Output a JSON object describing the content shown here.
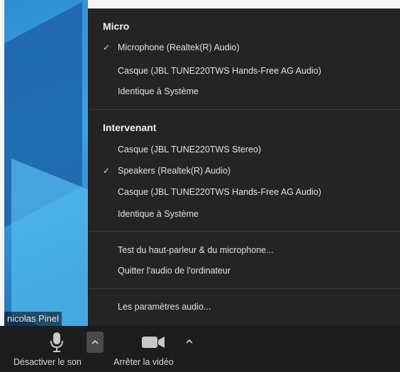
{
  "participant": {
    "name": "nicolas Pinel"
  },
  "audio_menu": {
    "micro_section": {
      "title": "Micro",
      "items": [
        {
          "label": "Microphone (Realtek(R) Audio)",
          "checked": true,
          "check_glyph": "✓"
        },
        {
          "label": "Casque (JBL TUNE220TWS Hands-Free AG Audio)",
          "checked": false,
          "check_glyph": ""
        },
        {
          "label": "Identique à Système",
          "checked": false,
          "check_glyph": ""
        }
      ]
    },
    "speaker_section": {
      "title": "Intervenant",
      "items": [
        {
          "label": "Casque (JBL TUNE220TWS Stereo)",
          "checked": false,
          "check_glyph": ""
        },
        {
          "label": "Speakers (Realtek(R) Audio)",
          "checked": true,
          "check_glyph": "✓"
        },
        {
          "label": "Casque (JBL TUNE220TWS Hands-Free AG Audio)",
          "checked": false,
          "check_glyph": ""
        },
        {
          "label": "Identique à Système",
          "checked": false,
          "check_glyph": ""
        }
      ]
    },
    "actions": {
      "test_label": "Test du haut-parleur & du microphone...",
      "leave_label": "Quitter l'audio de l'ordinateur",
      "settings_label": "Les paramètres audio..."
    }
  },
  "toolbar": {
    "mute_label": "Désactiver le son",
    "mute_icon": "microphone-icon",
    "stop_video_label": "Arrêter la vidéo",
    "video_icon": "video-camera-icon",
    "caret_icon": "chevron-up-icon"
  },
  "colors": {
    "menu_bg": "#242424",
    "toolbar_bg": "#1c1c1c",
    "separator": "#3d3d3d",
    "video_tile": "#2f8fd3"
  }
}
